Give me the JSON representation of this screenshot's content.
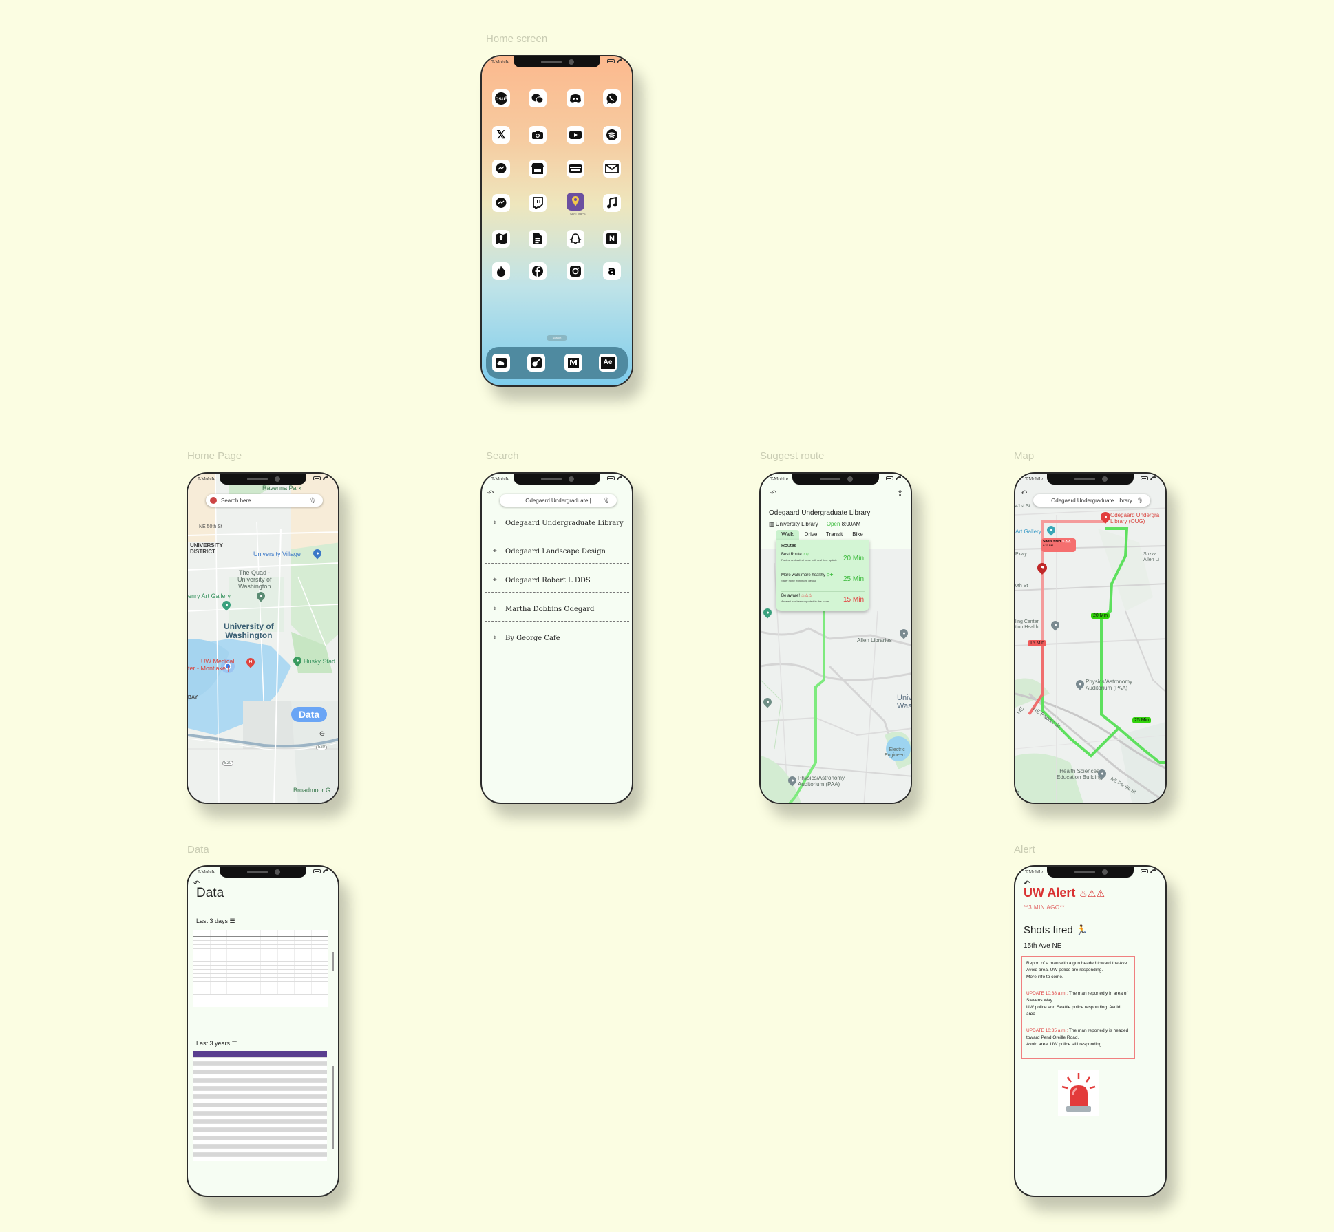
{
  "frames": {
    "home_screen": "Home screen",
    "home_page": "Home Page",
    "search": "Search",
    "suggest_route": "Suggest route",
    "map": "Map",
    "data": "Data",
    "alert": "Alert"
  },
  "status": {
    "carrier": "T-Mobile"
  },
  "homescreen": {
    "apps": [
      [
        "osu!",
        "",
        "",
        ""
      ],
      [
        "𝕏",
        "",
        "",
        ""
      ],
      [
        "",
        "",
        "",
        ""
      ],
      [
        "",
        "",
        "",
        ""
      ],
      [
        "",
        "",
        "",
        "N"
      ],
      [
        "",
        "",
        "",
        "a"
      ]
    ],
    "small_app_label": "SAFT MAPS",
    "search_pill": "Search",
    "dock": [
      "",
      "",
      "",
      "Ae"
    ]
  },
  "homepage": {
    "search_placeholder": "Search here",
    "labels": {
      "ravenna": "Ravenna Park",
      "ne50": "NE 50th St",
      "udistrict": "UNIVERSITY\nDISTRICT",
      "uvillage": "University Village",
      "quad": "The Quad -\nUniversity of\nWashington",
      "gallery": "enry Art Gallery",
      "uw": "University of\nWashington",
      "medical": "UW Medical\nter - Montlake |...",
      "husky": "Husky Stad",
      "bay": "BAY",
      "broadmoor": "Broadmoor G",
      "r520a": "520",
      "r520b": "520"
    },
    "data_button": "Data"
  },
  "search": {
    "query": "Odegaard Undergraduate |",
    "results": [
      "Odegaard Undergraduate Library",
      "Odegaard Landscape Design",
      "Odegaard Robert L DDS",
      "Martha Dobbins Odegard",
      "By George Cafe"
    ]
  },
  "route": {
    "title": "Odegaard Undergraduate Library",
    "type": "University Library",
    "open": "Open",
    "open_time": "8:00AM",
    "tabs": [
      "Walk",
      "Drive",
      "Transit",
      "Bike"
    ],
    "routes_header": "Routes",
    "options": [
      {
        "name": "Best Route",
        "desc": "Fastest and safest route with real time update",
        "time": "20 Min",
        "color": "#3dbb3d"
      },
      {
        "name": "More walk more healthy",
        "desc": "Safer route with more detour",
        "time": "25 Min",
        "color": "#3dbb3d"
      },
      {
        "name": "Be aware!",
        "desc": "An alert has been reported in this route!",
        "time": "15 Min",
        "color": "#e33b3b"
      }
    ],
    "map_labels": {
      "allen": "Allen Libraries",
      "univ": "Univ\nWas",
      "electric": "Electric\nEngineeri",
      "physics": "Physics/Astronomy\nAuditorium (PAA)"
    }
  },
  "mapscreen": {
    "search": "Odegaard Undergraduate Library",
    "labels": {
      "st41": "41st St",
      "artgallery": "Art Gallery",
      "odegaard": "Odegaard Undergra\nLibrary (OUG)",
      "pkwy": "Pkwy",
      "st40": "0th St",
      "suzza": "Suzza\nAllen Li",
      "healthctr": "ling Center\ntion Health",
      "physics": "Physics/Astronomy\nAuditorium (PAA)",
      "ne": "NE",
      "pacific": "NE Pacific St",
      "pacific2": "NE Pacific St",
      "hsc": "Health Sciences\nEducation Building",
      "a": "a"
    },
    "popup_title": "Shots fired",
    "popup_time": "6:37 PM",
    "badges": {
      "b20": "20 Min",
      "b15": "15 Min",
      "b25": "25 Min"
    }
  },
  "data": {
    "title": "Data",
    "last3days": "Last 3 days",
    "last3years": "Last 3 years"
  },
  "alert": {
    "title": "UW Alert",
    "time": "**3 MIN AGO**",
    "headline": "Shots fired",
    "street": "15th Ave NE",
    "p1a": "Report of a man with a gun headed toward the Ave.",
    "p1b": "Avoid area. UW police are responding.",
    "p1c": "More info to come.",
    "u1label": "UPDATE 10:38 a.m.:",
    "u1a": " The man reportedly in area of",
    "u1b": "Stevens Way.",
    "u1c": "UW police and Seattle police responding. Avoid area.",
    "u2label": "UPDATE 10:35 a.m.:",
    "u2a": " The man reportedly is headed",
    "u2b": "toward Pend Oreille Road.",
    "u2c": "Avoid area. UW police still responding."
  },
  "colors": {
    "background": "#fbfde2",
    "route_green": "#7ee87e",
    "alert_red": "#e33b3b",
    "data_blue": "#6aa5f5"
  }
}
